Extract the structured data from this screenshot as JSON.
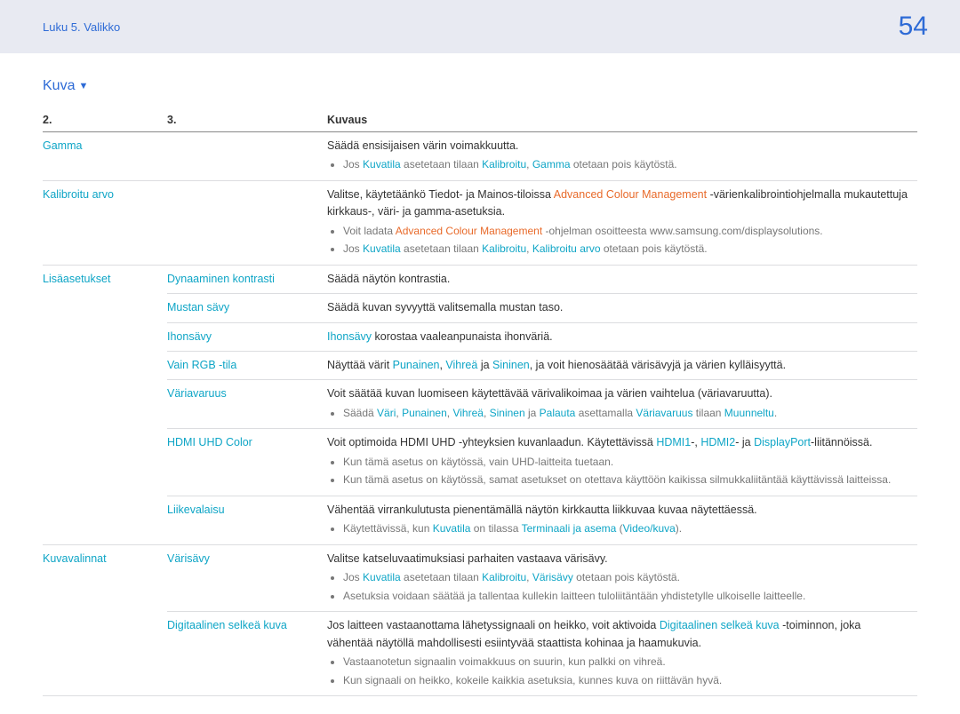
{
  "header": {
    "breadcrumb": "Luku 5. Valikko",
    "page": "54"
  },
  "section": {
    "title": "Kuva"
  },
  "columns": {
    "c1": "2.",
    "c2": "3.",
    "c3": "Kuvaus"
  },
  "rows": {
    "gamma": {
      "name": "Gamma",
      "desc": "Säädä ensisijaisen värin voimakkuutta.",
      "b1a": "Jos ",
      "b1b": "Kuvatila",
      "b1c": " asetetaan tilaan ",
      "b1d": "Kalibroitu",
      "b1e": ", ",
      "b1f": "Gamma",
      "b1g": " otetaan pois käytöstä."
    },
    "kalib": {
      "name": "Kalibroitu arvo",
      "d1": "Valitse, käytetäänkö Tiedot- ja Mainos-tiloissa ",
      "d2": "Advanced Colour Management",
      "d3": " -värienkalibrointiohjelmalla mukautettuja kirkkaus-, väri- ja gamma-asetuksia.",
      "b1a": "Voit ladata ",
      "b1b": "Advanced Colour Management",
      "b1c": " -ohjelman osoitteesta www.samsung.com/displaysolutions.",
      "b2a": "Jos ",
      "b2b": "Kuvatila",
      "b2c": " asetetaan tilaan ",
      "b2d": "Kalibroitu",
      "b2e": ", ",
      "b2f": "Kalibroitu arvo",
      "b2g": " otetaan pois käytöstä."
    },
    "lisa": {
      "name": "Lisäasetukset"
    },
    "dyn": {
      "name": "Dynaaminen kontrasti",
      "desc": "Säädä näytön kontrastia."
    },
    "mustan": {
      "name": "Mustan sävy",
      "desc": "Säädä kuvan syvyyttä valitsemalla mustan taso."
    },
    "ihon": {
      "name": "Ihonsävy",
      "d1": "Ihonsävy",
      "d2": " korostaa vaaleanpunaista ihonväriä."
    },
    "rgb": {
      "name": "Vain RGB -tila",
      "d1": "Näyttää värit ",
      "p": "Punainen",
      "c": ", ",
      "v": "Vihreä",
      "j": " ja ",
      "s": "Sininen",
      "d2": ", ja voit hienosäätää värisävyjä ja värien kylläisyyttä."
    },
    "varia": {
      "name": "Väriavaruus",
      "desc": "Voit säätää kuvan luomiseen käytettävää värivalikoimaa ja värien vaihtelua (väriavaruutta).",
      "b1a": "Säädä ",
      "b1b": "Väri",
      "b1c": ", ",
      "b1d": "Punainen",
      "b1e": ", ",
      "b1f": "Vihreä",
      "b1g": ", ",
      "b1h": "Sininen",
      "b1i": " ja ",
      "b1j": "Palauta",
      "b1k": " asettamalla ",
      "b1l": "Väriavaruus",
      "b1m": " tilaan ",
      "b1n": "Muunneltu",
      "b1o": "."
    },
    "hdmi": {
      "name": "HDMI UHD Color",
      "d1": "Voit optimoida HDMI UHD -yhteyksien kuvanlaadun. Käytettävissä ",
      "d2": "HDMI1",
      "d3": "-, ",
      "d4": "HDMI2",
      "d5": "- ja ",
      "d6": "DisplayPort",
      "d7": "-liitännöissä.",
      "b1": "Kun tämä asetus on käytössä, vain UHD-laitteita tuetaan.",
      "b2": "Kun tämä asetus on käytössä, samat asetukset on otettava käyttöön kaikissa silmukkaliitäntää käyttävissä laitteissa."
    },
    "liike": {
      "name": "Liikevalaisu",
      "desc": "Vähentää virrankulutusta pienentämällä näytön kirkkautta liikkuvaa kuvaa näytettäessä.",
      "b1a": "Käytettävissä, kun ",
      "b1b": "Kuvatila",
      "b1c": " on tilassa ",
      "b1d": "Terminaali ja asema",
      "b1e": " (",
      "b1f": "Video/kuva",
      "b1g": ")."
    },
    "kuvaval": {
      "name": "Kuvavalinnat"
    },
    "varis": {
      "name": "Värisävy",
      "desc": "Valitse katseluvaatimuksiasi parhaiten vastaava värisävy.",
      "b1a": "Jos ",
      "b1b": "Kuvatila",
      "b1c": " asetetaan tilaan ",
      "b1d": "Kalibroitu",
      "b1e": ", ",
      "b1f": "Värisävy",
      "b1g": " otetaan pois käytöstä.",
      "b2": "Asetuksia voidaan säätää ja tallentaa kullekin laitteen tuloliitäntään yhdistetylle ulkoiselle laitteelle."
    },
    "digi": {
      "name": "Digitaalinen selkeä kuva",
      "d1": "Jos laitteen vastaanottama lähetyssignaali on heikko, voit aktivoida ",
      "d2": "Digitaalinen selkeä kuva",
      "d3": " -toiminnon, joka vähentää näytöllä mahdollisesti esiintyvää staattista kohinaa ja haamukuvia.",
      "b1": "Vastaanotetun signaalin voimakkuus on suurin, kun palkki on vihreä.",
      "b2": "Kun signaali on heikko, kokeile kaikkia asetuksia, kunnes kuva on riittävän hyvä."
    }
  }
}
